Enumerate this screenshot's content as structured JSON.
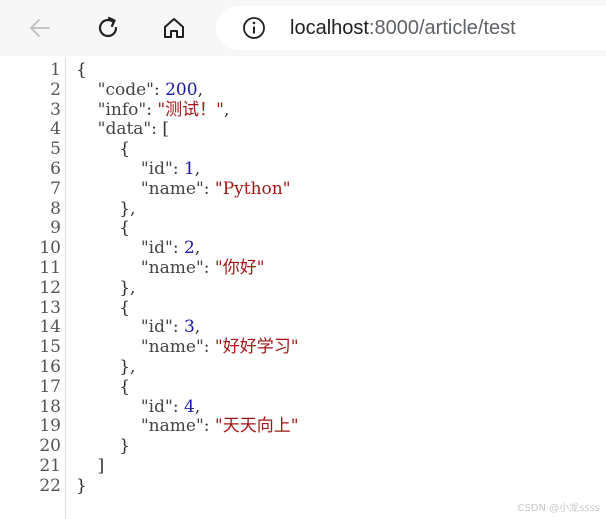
{
  "browser": {
    "url_host": "localhost",
    "url_rest": ":8000/article/test",
    "back_icon": "arrow-left-icon",
    "reload_icon": "reload-icon",
    "home_icon": "home-icon",
    "site_info_icon": "info-circle-icon",
    "colors": {
      "toolbar_bg": "#f7f7f7",
      "string": "#a31515",
      "number": "#1a1aa6"
    }
  },
  "json_view": {
    "lines": [
      {
        "num": "1",
        "indent": "",
        "tokens": [
          {
            "t": "p",
            "v": "{"
          }
        ]
      },
      {
        "num": "2",
        "indent": "    ",
        "tokens": [
          {
            "t": "k",
            "v": "\"code\""
          },
          {
            "t": "p",
            "v": ": "
          },
          {
            "t": "n",
            "v": "200"
          },
          {
            "t": "p",
            "v": ","
          }
        ]
      },
      {
        "num": "3",
        "indent": "    ",
        "tokens": [
          {
            "t": "k",
            "v": "\"info\""
          },
          {
            "t": "p",
            "v": ": "
          },
          {
            "t": "s",
            "v": "\"测试！\""
          },
          {
            "t": "p",
            "v": ","
          }
        ]
      },
      {
        "num": "4",
        "indent": "    ",
        "tokens": [
          {
            "t": "k",
            "v": "\"data\""
          },
          {
            "t": "p",
            "v": ": ["
          }
        ]
      },
      {
        "num": "5",
        "indent": "        ",
        "tokens": [
          {
            "t": "p",
            "v": "{"
          }
        ]
      },
      {
        "num": "6",
        "indent": "            ",
        "tokens": [
          {
            "t": "k",
            "v": "\"id\""
          },
          {
            "t": "p",
            "v": ": "
          },
          {
            "t": "n",
            "v": "1"
          },
          {
            "t": "p",
            "v": ","
          }
        ]
      },
      {
        "num": "7",
        "indent": "            ",
        "tokens": [
          {
            "t": "k",
            "v": "\"name\""
          },
          {
            "t": "p",
            "v": ": "
          },
          {
            "t": "s",
            "v": "\"Python\""
          }
        ]
      },
      {
        "num": "8",
        "indent": "        ",
        "tokens": [
          {
            "t": "p",
            "v": "},"
          }
        ]
      },
      {
        "num": "9",
        "indent": "        ",
        "tokens": [
          {
            "t": "p",
            "v": "{"
          }
        ]
      },
      {
        "num": "10",
        "indent": "            ",
        "tokens": [
          {
            "t": "k",
            "v": "\"id\""
          },
          {
            "t": "p",
            "v": ": "
          },
          {
            "t": "n",
            "v": "2"
          },
          {
            "t": "p",
            "v": ","
          }
        ]
      },
      {
        "num": "11",
        "indent": "            ",
        "tokens": [
          {
            "t": "k",
            "v": "\"name\""
          },
          {
            "t": "p",
            "v": ": "
          },
          {
            "t": "s",
            "v": "\"你好\""
          }
        ]
      },
      {
        "num": "12",
        "indent": "        ",
        "tokens": [
          {
            "t": "p",
            "v": "},"
          }
        ]
      },
      {
        "num": "13",
        "indent": "        ",
        "tokens": [
          {
            "t": "p",
            "v": "{"
          }
        ]
      },
      {
        "num": "14",
        "indent": "            ",
        "tokens": [
          {
            "t": "k",
            "v": "\"id\""
          },
          {
            "t": "p",
            "v": ": "
          },
          {
            "t": "n",
            "v": "3"
          },
          {
            "t": "p",
            "v": ","
          }
        ]
      },
      {
        "num": "15",
        "indent": "            ",
        "tokens": [
          {
            "t": "k",
            "v": "\"name\""
          },
          {
            "t": "p",
            "v": ": "
          },
          {
            "t": "s",
            "v": "\"好好学习\""
          }
        ]
      },
      {
        "num": "16",
        "indent": "        ",
        "tokens": [
          {
            "t": "p",
            "v": "},"
          }
        ]
      },
      {
        "num": "17",
        "indent": "        ",
        "tokens": [
          {
            "t": "p",
            "v": "{"
          }
        ]
      },
      {
        "num": "18",
        "indent": "            ",
        "tokens": [
          {
            "t": "k",
            "v": "\"id\""
          },
          {
            "t": "p",
            "v": ": "
          },
          {
            "t": "n",
            "v": "4"
          },
          {
            "t": "p",
            "v": ","
          }
        ]
      },
      {
        "num": "19",
        "indent": "            ",
        "tokens": [
          {
            "t": "k",
            "v": "\"name\""
          },
          {
            "t": "p",
            "v": ": "
          },
          {
            "t": "s",
            "v": "\"天天向上\""
          }
        ]
      },
      {
        "num": "20",
        "indent": "        ",
        "tokens": [
          {
            "t": "p",
            "v": "}"
          }
        ]
      },
      {
        "num": "21",
        "indent": "    ",
        "tokens": [
          {
            "t": "p",
            "v": "]"
          }
        ]
      },
      {
        "num": "22",
        "indent": "",
        "tokens": [
          {
            "t": "p",
            "v": "}"
          }
        ]
      }
    ]
  },
  "watermark": "CSDN @小龙ssss"
}
